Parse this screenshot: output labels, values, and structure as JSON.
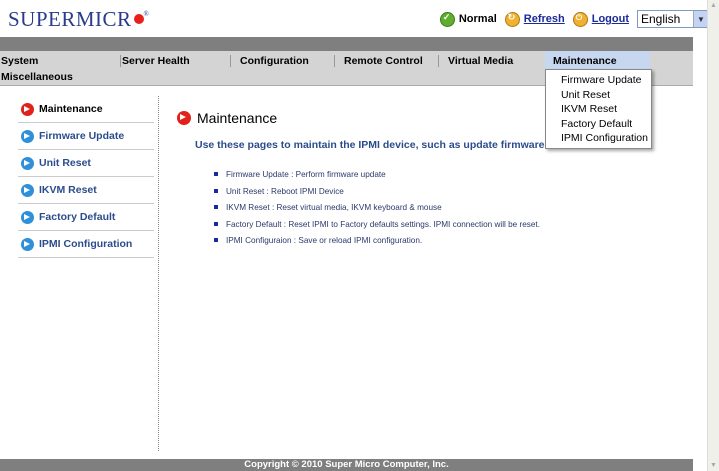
{
  "header": {
    "logo": "SUPERMICR",
    "status_label": "Normal",
    "refresh_label": "Refresh",
    "logout_label": "Logout",
    "language": "English"
  },
  "nav": {
    "tabs": [
      "System",
      "Server Health",
      "Configuration",
      "Remote Control",
      "Virtual Media",
      "Maintenance"
    ],
    "second_row": "Miscellaneous",
    "active_tab": "Maintenance",
    "dropdown": [
      "Firmware Update",
      "Unit Reset",
      "IKVM Reset",
      "Factory Default",
      "IPMI Configuration"
    ]
  },
  "sidebar": {
    "items": [
      "Maintenance",
      "Firmware Update",
      "Unit Reset",
      "IKVM Reset",
      "Factory Default",
      "IPMI Configuration"
    ]
  },
  "main": {
    "title": "Maintenance",
    "intro": "Use these pages to maintain the IPMI device, such as update firmware or reset the IPMI device.",
    "bullets": [
      "Firmware Update : Perform firmware update",
      "Unit Reset : Reboot IPMI Device",
      "IKVM Reset : Reset virtual media, IKVM keyboard & mouse",
      "Factory Default : Reset IPMI to Factory defaults settings. IPMI connection will be reset.",
      "IPMI Configuraion : Save or reload IPMI configuration."
    ]
  },
  "footer": {
    "copyright": "Copyright © 2010 Super Micro Computer, Inc."
  },
  "colors": {
    "brand": "#2a3a8c",
    "link": "#1a2a9a",
    "accent_red": "#e0221a",
    "accent_blue": "#2f8fd8",
    "nav_bg": "#d4d4d4",
    "active_tab_bg": "#c8d7f0"
  }
}
